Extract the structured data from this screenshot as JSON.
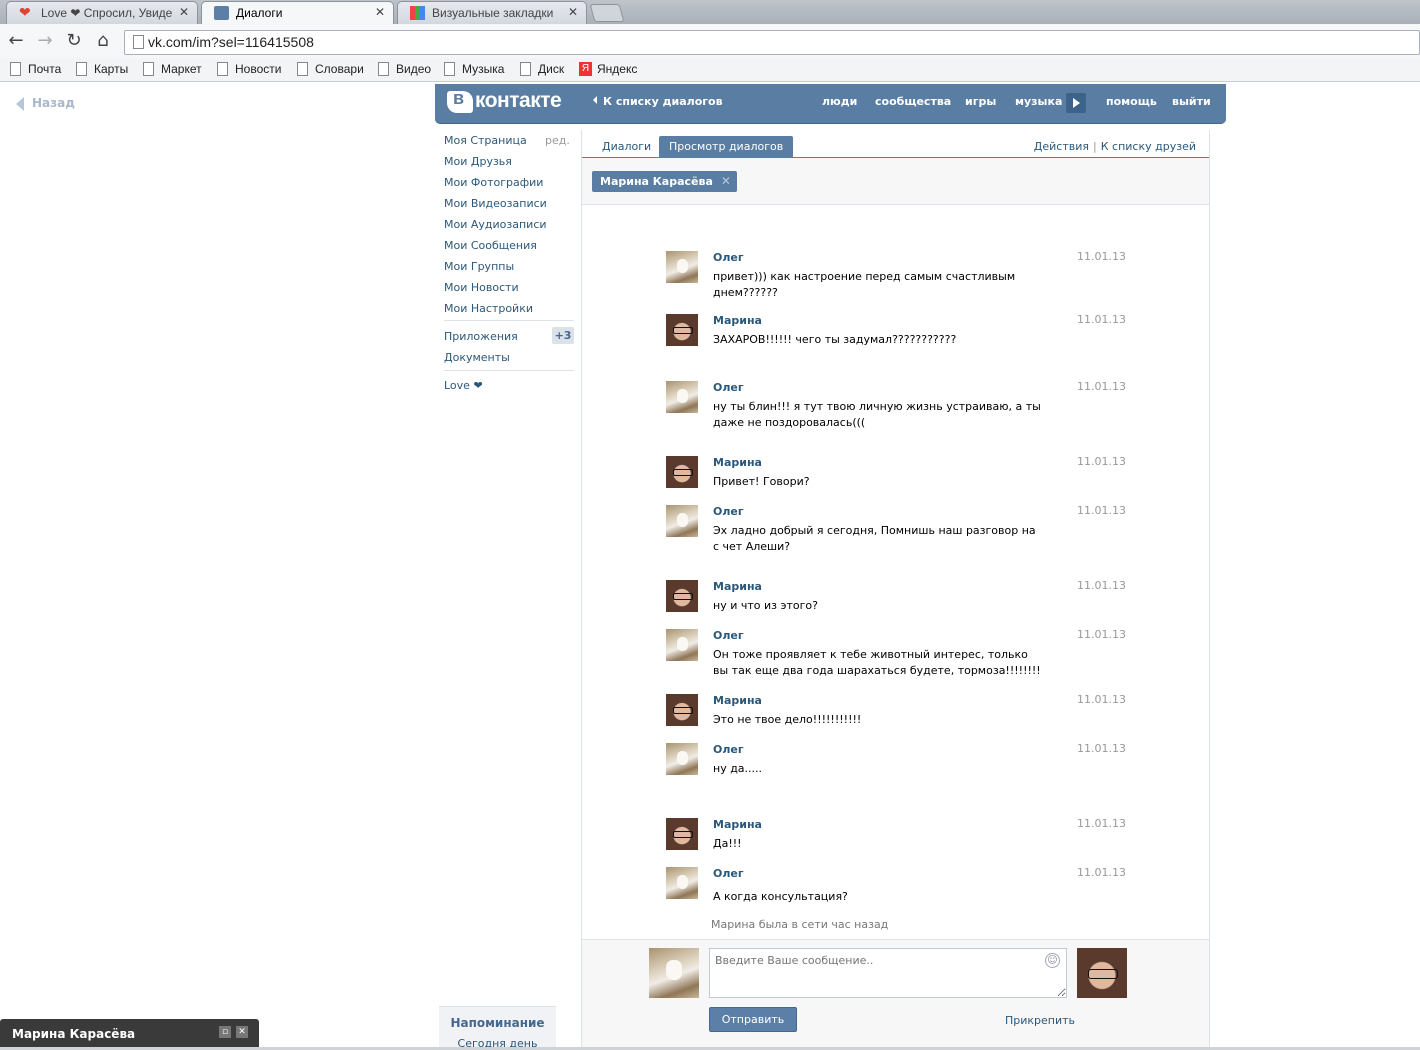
{
  "browser": {
    "tabs": [
      {
        "title": "Love ❤ Спросил, Увиде",
        "icon": "heart-favicon"
      },
      {
        "title": "Диалоги",
        "icon": "vk-messages-favicon"
      },
      {
        "title": "Визуальные закладки",
        "icon": "grid-favicon"
      }
    ],
    "close_glyph": "✕",
    "url": "vk.com/im?sel=116415508",
    "bookmarks": [
      "Почта",
      "Карты",
      "Маркет",
      "Новости",
      "Словари",
      "Видео",
      "Музыка",
      "Диск",
      "Яндекс"
    ]
  },
  "page": {
    "back_label": "Назад"
  },
  "header": {
    "logo_text": "контакте",
    "back_to_dialogs": "К списку диалогов",
    "links": [
      "люди",
      "сообщества",
      "игры",
      "музыка",
      "помощь",
      "выйти"
    ],
    "brand_color": "#597da3"
  },
  "left_menu": {
    "items": [
      "Моя Страница",
      "Мои Друзья",
      "Мои Фотографии",
      "Мои Видеозаписи",
      "Мои Аудиозаписи",
      "Мои Сообщения",
      "Мои Группы",
      "Мои Новости",
      "Мои Настройки"
    ],
    "edit_label": "ред.",
    "apps_label": "Приложения",
    "apps_badge": "+3",
    "docs_label": "Документы",
    "love_label": "Love ❤"
  },
  "im": {
    "tabs": [
      "Диалоги",
      "Просмотр диалогов"
    ],
    "actions_label": "Действия",
    "friends_link": "К списку друзей",
    "separator": "|",
    "peer_chip": "Марина Карасёва",
    "messages": [
      {
        "author": "Олег",
        "date": "11.01.13",
        "text": "привет))) как настроение перед  самым счастливым днем??????"
      },
      {
        "author": "Марина",
        "date": "11.01.13",
        "text": "ЗАХАРОВ!!!!!! чего ты задумал???????????"
      },
      {
        "author": "Олег",
        "date": "11.01.13",
        "text": "ну ты блин!!! я тут твою личную жизнь устраиваю, а ты даже не поздоровалась((("
      },
      {
        "author": "Марина",
        "date": "11.01.13",
        "text": "Привет! Говори?"
      },
      {
        "author": "Олег",
        "date": "11.01.13",
        "text": "Эх ладно добрый я сегодня, Помнишь наш разговор на с чет Алеши?"
      },
      {
        "author": "Марина",
        "date": "11.01.13",
        "text": "ну и что из этого?"
      },
      {
        "author": "Олег",
        "date": "11.01.13",
        "text": "Он тоже проявляет к тебе животный интерес, только вы так еще два года шарахаться будете, тормоза!!!!!!!!"
      },
      {
        "author": "Марина",
        "date": "11.01.13",
        "text": "Это не твое дело!!!!!!!!!!!"
      },
      {
        "author": "Олег",
        "date": "11.01.13",
        "text": "ну да....."
      },
      {
        "author": "Марина",
        "date": "11.01.13",
        "text": "Да!!!"
      },
      {
        "author": "Олег",
        "date": "11.01.13",
        "text": "А когда консультация?"
      }
    ],
    "last_seen": "Марина была в сети час назад",
    "input_placeholder": "Введите Ваше сообщение..",
    "send_label": "Отправить",
    "attach_label": "Прикрепить"
  },
  "reminder": {
    "title": "Напоминание",
    "subtitle": "Сегодня день"
  },
  "chat_bar": {
    "name": "Марина Карасёва"
  }
}
